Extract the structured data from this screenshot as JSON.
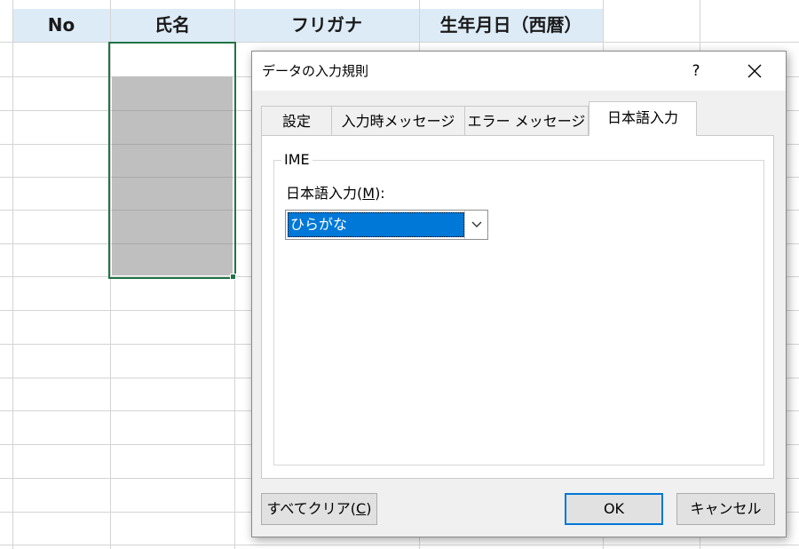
{
  "sheet": {
    "columns": [
      "No",
      "氏名",
      "フリガナ",
      "生年月日（西暦）"
    ]
  },
  "dialog": {
    "title": "データの入力規則",
    "help_label": "?",
    "close_label": "✕",
    "tabs": [
      {
        "label": "設定",
        "active": false
      },
      {
        "label": "入力時メッセージ",
        "active": false
      },
      {
        "label": "エラー メッセージ",
        "active": false
      },
      {
        "label": "日本語入力",
        "active": true
      }
    ],
    "ime_group": {
      "legend": "IME",
      "field_label_prefix": "日本語入力(",
      "field_label_accel": "M",
      "field_label_suffix": "):",
      "selected_value": "ひらがな"
    },
    "buttons": {
      "clear_all_prefix": "すべてクリア(",
      "clear_all_accel": "C",
      "clear_all_suffix": ")",
      "ok": "OK",
      "cancel": "キャンセル"
    }
  },
  "colors": {
    "header_band": "#ddebf7",
    "selection_border": "#217346",
    "selection_fill": "#bfbfbf",
    "highlight": "#0078d7"
  },
  "icons": {
    "dropdown": "chevron-down-icon",
    "close": "close-icon",
    "help": "help-icon"
  }
}
